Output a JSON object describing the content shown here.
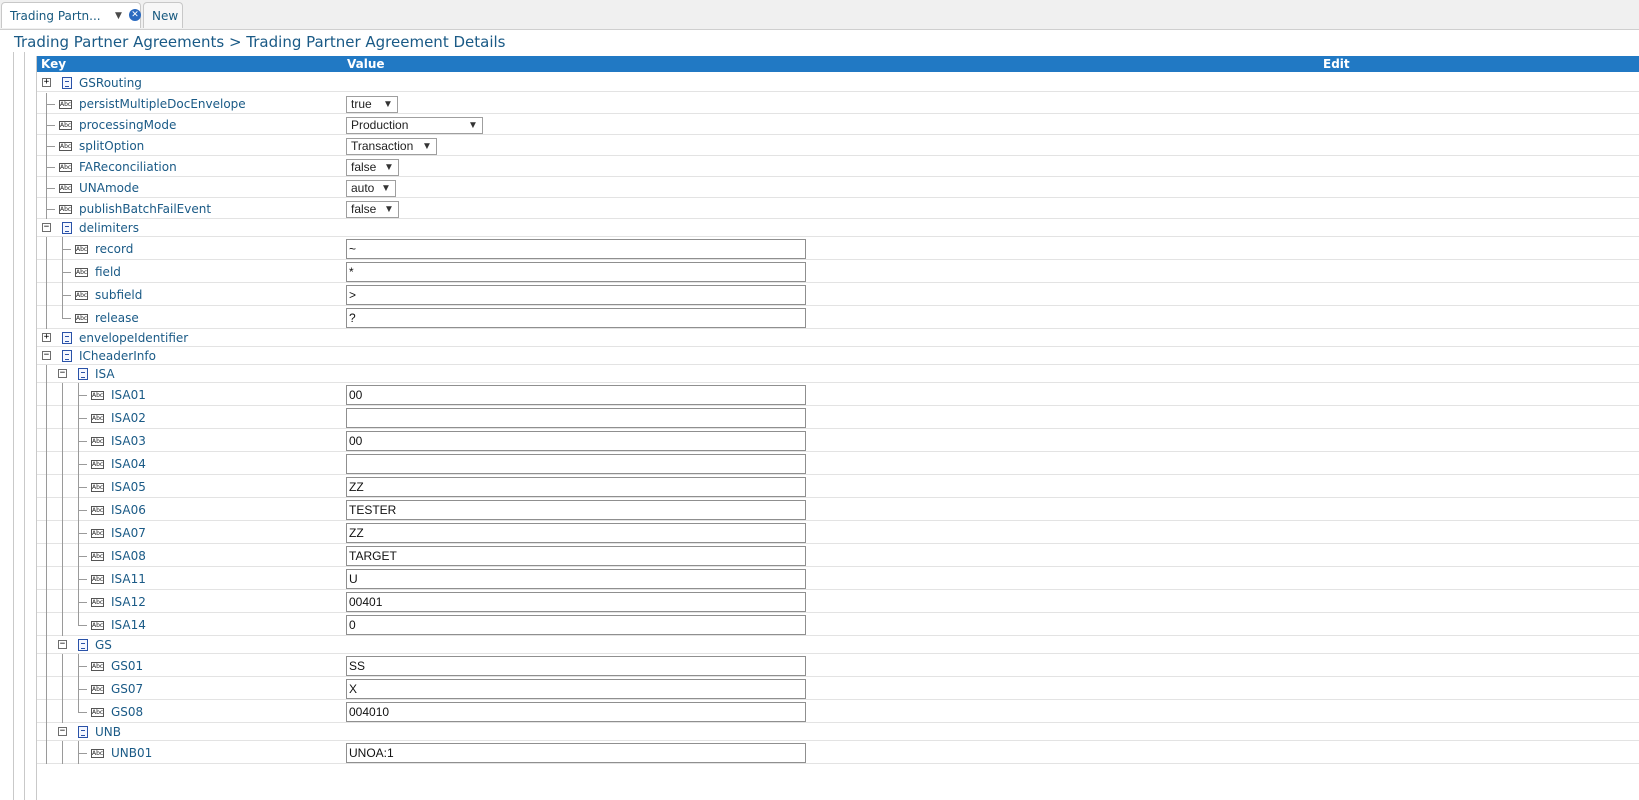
{
  "tabs": [
    {
      "label": "Trading Partn..."
    },
    {
      "label": "New"
    }
  ],
  "breadcrumb": "Trading Partner Agreements > Trading Partner Agreement Details",
  "grid": {
    "headers": {
      "key": "Key",
      "value": "Value",
      "edit": "Edit"
    }
  },
  "rows": [
    {
      "key": "GSRouting",
      "type": "folder",
      "expander": "+"
    },
    {
      "key": "persistMultipleDocEnvelope",
      "type": "select",
      "value": "true"
    },
    {
      "key": "processingMode",
      "type": "select",
      "value": "Production"
    },
    {
      "key": "splitOption",
      "type": "select",
      "value": "Transaction"
    },
    {
      "key": "FAReconciliation",
      "type": "select",
      "value": "false"
    },
    {
      "key": "UNAmode",
      "type": "select",
      "value": "auto"
    },
    {
      "key": "publishBatchFailEvent",
      "type": "select",
      "value": "false"
    },
    {
      "key": "delimiters",
      "type": "folder",
      "expander": "−"
    },
    {
      "key": "record",
      "type": "text",
      "value": "~"
    },
    {
      "key": "field",
      "type": "text",
      "value": "*"
    },
    {
      "key": "subfield",
      "type": "text",
      "value": ">"
    },
    {
      "key": "release",
      "type": "text",
      "value": "?"
    },
    {
      "key": "envelopeIdentifier",
      "type": "folder",
      "expander": "+"
    },
    {
      "key": "ICheaderInfo",
      "type": "folder",
      "expander": "−"
    },
    {
      "key": "ISA",
      "type": "folder",
      "expander": "−"
    },
    {
      "key": "ISA01",
      "type": "text",
      "value": "00"
    },
    {
      "key": "ISA02",
      "type": "text",
      "value": ""
    },
    {
      "key": "ISA03",
      "type": "text",
      "value": "00"
    },
    {
      "key": "ISA04",
      "type": "text",
      "value": ""
    },
    {
      "key": "ISA05",
      "type": "text",
      "value": "ZZ"
    },
    {
      "key": "ISA06",
      "type": "text",
      "value": "TESTER"
    },
    {
      "key": "ISA07",
      "type": "text",
      "value": "ZZ"
    },
    {
      "key": "ISA08",
      "type": "text",
      "value": "TARGET"
    },
    {
      "key": "ISA11",
      "type": "text",
      "value": "U"
    },
    {
      "key": "ISA12",
      "type": "text",
      "value": "00401"
    },
    {
      "key": "ISA14",
      "type": "text",
      "value": "0"
    },
    {
      "key": "GS",
      "type": "folder",
      "expander": "−"
    },
    {
      "key": "GS01",
      "type": "text",
      "value": "SS"
    },
    {
      "key": "GS07",
      "type": "text",
      "value": "X"
    },
    {
      "key": "GS08",
      "type": "text",
      "value": "004010"
    },
    {
      "key": "UNB",
      "type": "folder",
      "expander": "−"
    },
    {
      "key": "UNB01",
      "type": "text",
      "value": "UNOA:1"
    }
  ],
  "icons": {
    "leaf": "abc-field-icon",
    "folder": "document-icon",
    "collapse": "minus-box-icon",
    "expand": "plus-box-icon",
    "close": "close-icon",
    "dropdown": "chevron-down-icon"
  },
  "colors": {
    "header_bg": "#2179c4",
    "link_text": "#1a5a86",
    "close_badge": "#2a6ac0"
  }
}
